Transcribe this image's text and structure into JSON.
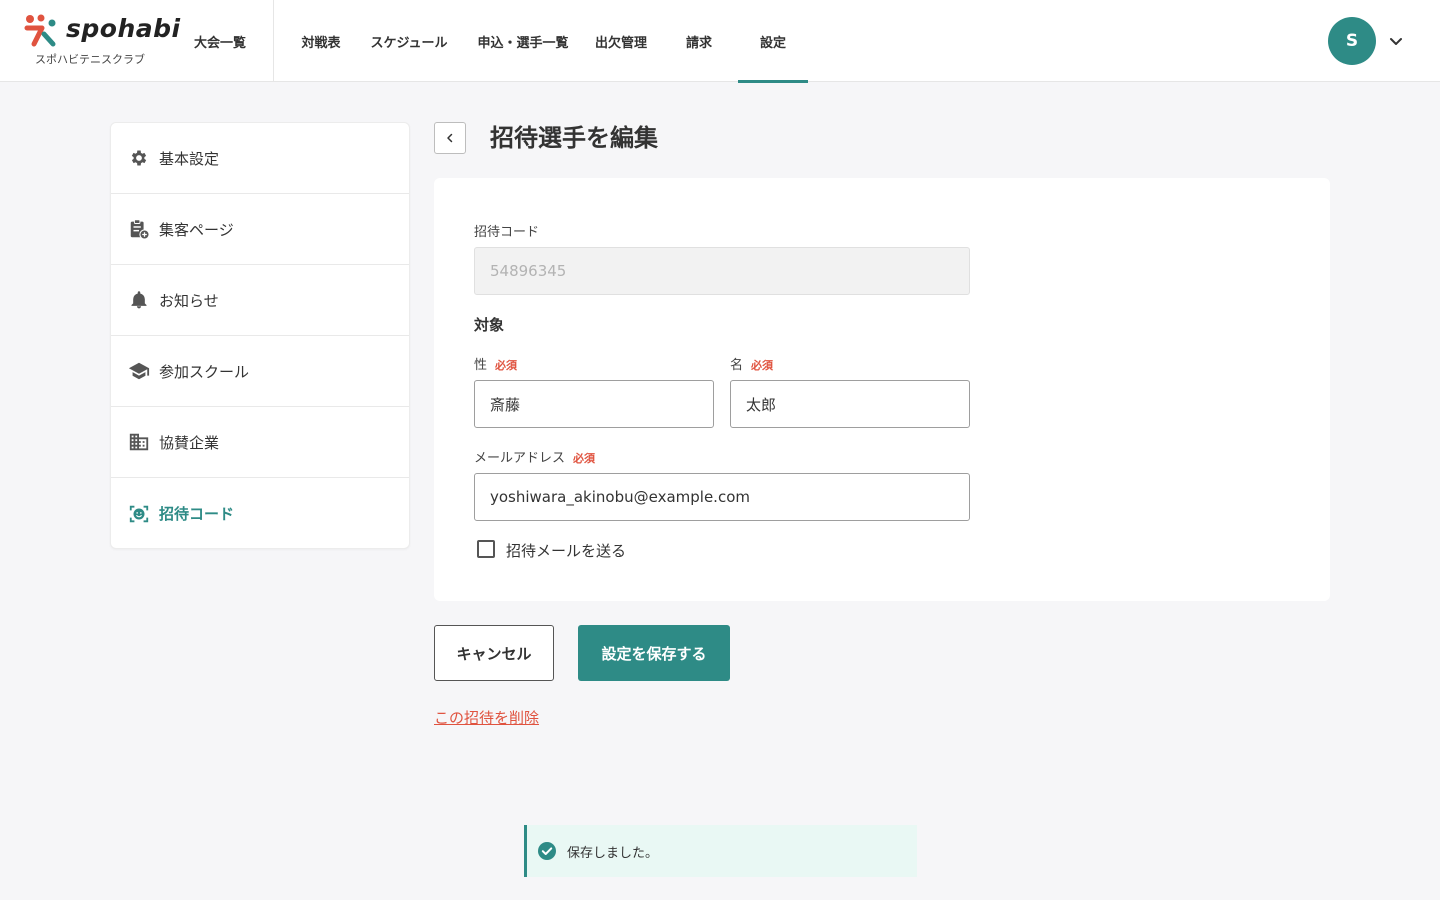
{
  "header": {
    "logo_text": "spohabi",
    "club_name": "スポハビテニスクラブ",
    "first_nav": "大会一覧",
    "nav_items": [
      {
        "label": "対戦表"
      },
      {
        "label": "スケジュール"
      },
      {
        "label": "申込・選手一覧"
      },
      {
        "label": "出欠管理"
      },
      {
        "label": "請求"
      },
      {
        "label": "設定"
      }
    ],
    "active_nav": "設定",
    "avatar_initial": "S"
  },
  "sidebar": {
    "items": [
      {
        "label": "基本設定",
        "icon": "gear-icon"
      },
      {
        "label": "集客ページ",
        "icon": "clipboard-add-icon"
      },
      {
        "label": "お知らせ",
        "icon": "bell-icon"
      },
      {
        "label": "参加スクール",
        "icon": "graduation-cap-icon"
      },
      {
        "label": "協賛企業",
        "icon": "building-icon"
      },
      {
        "label": "招待コード",
        "icon": "face-scan-icon"
      }
    ],
    "active": "招待コード"
  },
  "page": {
    "title": "招待選手を編集"
  },
  "form": {
    "invite_code_label": "招待コード",
    "invite_code_value": "54896345",
    "target_heading": "対象",
    "last_name_label": "性",
    "last_name_value": "斎藤",
    "first_name_label": "名",
    "first_name_value": "太郎",
    "required_badge": "必須",
    "email_label": "メールアドレス",
    "email_value": "yoshiwara_akinobu@example.com",
    "send_mail_label": "招待メールを送る",
    "send_mail_checked": false
  },
  "actions": {
    "cancel_label": "キャンセル",
    "save_label": "設定を保存する",
    "delete_label": "この招待を削除"
  },
  "toast": {
    "message": "保存しました。"
  },
  "colors": {
    "accent": "#2e8b86",
    "danger": "#e0533f",
    "toast_bg": "#e9f8f4"
  }
}
